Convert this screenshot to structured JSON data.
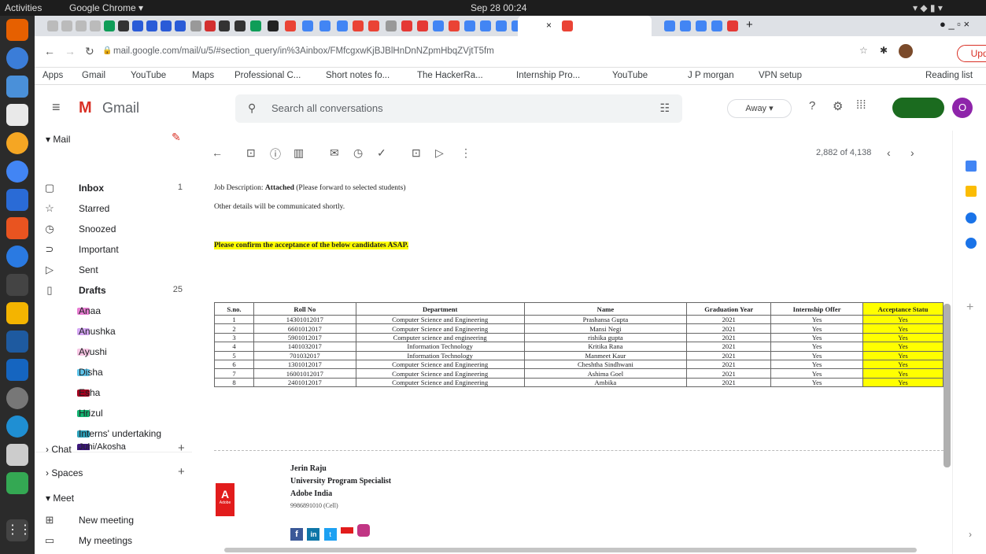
{
  "os": {
    "activities": "Activities",
    "app": "Google Chrome ▾",
    "clock": "Sep 28  00:24"
  },
  "browser": {
    "url": "mail.google.com/mail/u/5/#section_query/in%3Ainbox/FMfcgxwKjBJBlHnDnNZpmHbqZVjtT5fm",
    "update": "Update",
    "bookmarks": [
      "Apps",
      "Gmail",
      "YouTube",
      "Maps",
      "Professional C...",
      "Short notes fo...",
      "The HackerRa...",
      "Internship Pro...",
      "YouTube",
      "J P morgan",
      "VPN setup",
      "Reading list"
    ]
  },
  "gmail": {
    "logo": "Gmail",
    "search_placeholder": "Search all conversations",
    "status": "Away ▾",
    "avatar": "O",
    "mail_label": "Mail",
    "nav": [
      {
        "label": "Inbox",
        "count": "1"
      },
      {
        "label": "Starred",
        "count": ""
      },
      {
        "label": "Snoozed",
        "count": ""
      },
      {
        "label": "Important",
        "count": ""
      },
      {
        "label": "Sent",
        "count": ""
      },
      {
        "label": "Drafts",
        "count": "25"
      }
    ],
    "labels": [
      {
        "label": "Anaa",
        "color": "#e87ed2"
      },
      {
        "label": "Anushka",
        "color": "#d5a7f4"
      },
      {
        "label": "Ayushi",
        "color": "#f8c6e4"
      },
      {
        "label": "Disha",
        "color": "#5ec3e8"
      },
      {
        "label": "Esha",
        "color": "#a3001f"
      },
      {
        "label": "Hrizul",
        "color": "#14b371"
      },
      {
        "label": "Interns' undertaking",
        "color": "#2da2bb"
      },
      {
        "label": "Juhi/Akosha",
        "color": "#3d187c"
      }
    ],
    "chat": "Chat",
    "spaces": "Spaces",
    "meet": "Meet",
    "new_meeting": "New meeting",
    "my_meetings": "My meetings",
    "pager": "2,882 of 4,138"
  },
  "email": {
    "job_desc_prefix": "Job Description: ",
    "job_desc_bold": "Attached",
    "job_desc_suffix": " (Please forward to selected students)",
    "other_details": "Other details will be communicated shortly.",
    "confirm": "Please confirm the acceptance of the below candidates ASAP.",
    "table": {
      "headers": [
        "S.no.",
        "Roll No",
        "Department",
        "Name",
        "Graduation Year",
        "Internship Offer",
        "Acceptance Statu"
      ],
      "rows": [
        [
          "1",
          "14301012017",
          "Computer Science and Engineering",
          "Prashansa Gupta",
          "2021",
          "Yes",
          "Yes"
        ],
        [
          "2",
          "6601012017",
          "Computer Science and Engineering",
          "Mansi Negi",
          "2021",
          "Yes",
          "Yes"
        ],
        [
          "3",
          "5901012017",
          "Computer science and engineering",
          "rishika gupta",
          "2021",
          "Yes",
          "Yes"
        ],
        [
          "4",
          "1401032017",
          "Information Technology",
          "Kritika Rana",
          "2021",
          "Yes",
          "Yes"
        ],
        [
          "5",
          "701032017",
          "Information Technology",
          "Manmeet Kaur",
          "2021",
          "Yes",
          "Yes"
        ],
        [
          "6",
          "1301012017",
          "Computer Science and Engineering",
          "Cheshtha Sindhwani",
          "2021",
          "Yes",
          "Yes"
        ],
        [
          "7",
          "16001012017",
          "Computer Science and Engineering",
          "Ashima Goel",
          "2021",
          "Yes",
          "Yes"
        ],
        [
          "8",
          "2401012017",
          "Computer Science and Engineering",
          "Ambika",
          "2021",
          "Yes",
          "Yes"
        ]
      ]
    },
    "signature": {
      "name": "Jerin Raju",
      "title": "University Program Specialist",
      "company": "Adobe India",
      "phone": "9986891010 (Cell)",
      "logo_text": "Adobe"
    }
  }
}
